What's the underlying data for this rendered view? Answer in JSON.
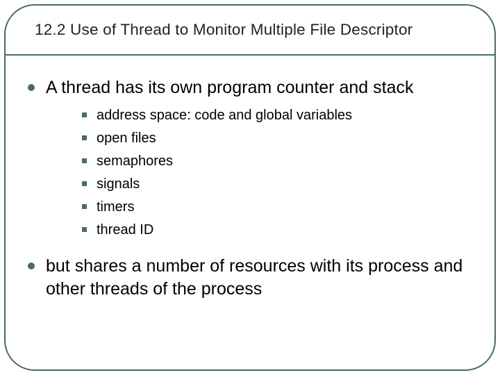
{
  "title": "12.2 Use of Thread to Monitor Multiple File Descriptor",
  "points": [
    {
      "text": "A thread has its own program counter and stack",
      "sub": [
        "address space: code and global variables",
        "open files",
        "semaphores",
        "signals",
        "timers",
        "thread ID"
      ]
    },
    {
      "text": "but shares a number of resources with its process and other threads of the process",
      "sub": []
    }
  ]
}
